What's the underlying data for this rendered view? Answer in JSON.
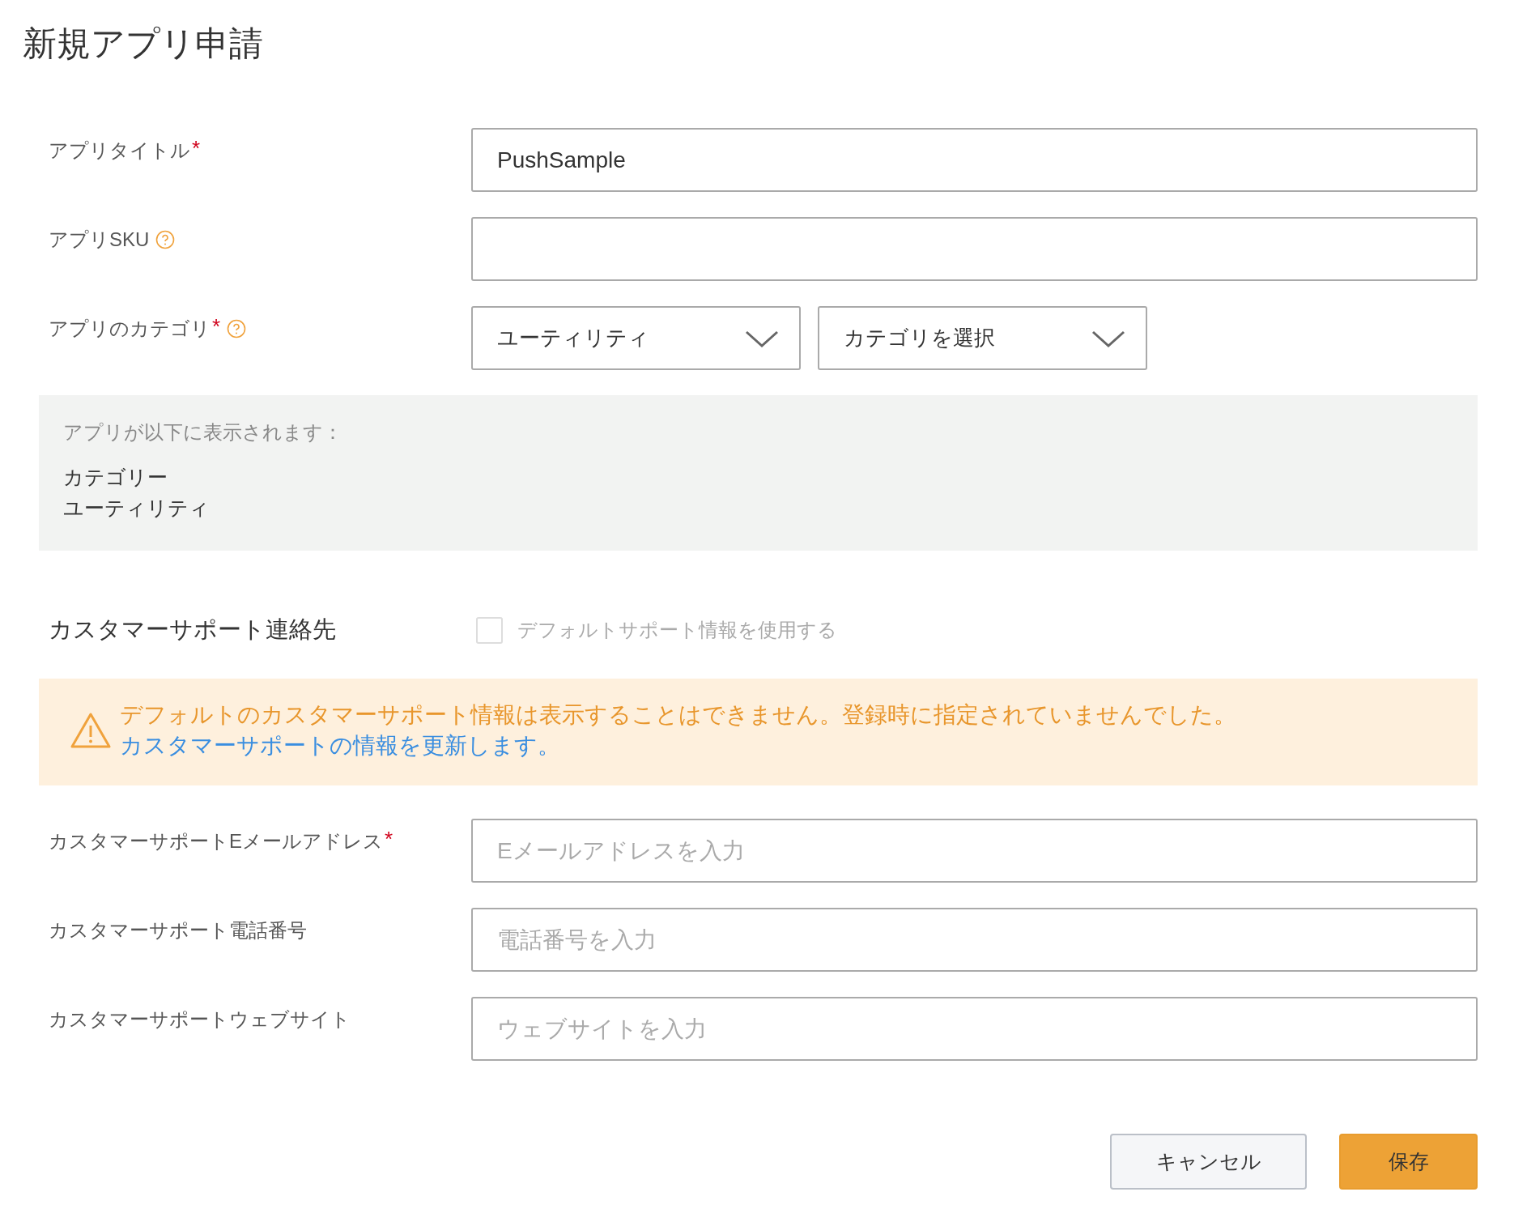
{
  "title": "新規アプリ申請",
  "app_fields": [
    {
      "kind": "text",
      "label": "アプリタイトル",
      "required_mark": "*",
      "help": false,
      "value": "PushSample"
    },
    {
      "kind": "text",
      "label": "アプリSKU",
      "help": true
    },
    {
      "kind": "select",
      "label": "アプリのカテゴリ",
      "required_mark": "*",
      "help": true,
      "selects": [
        {
          "value": "ユーティリティ"
        },
        {
          "value": "カテゴリを選択"
        }
      ]
    }
  ],
  "preview": {
    "heading": "アプリが以下に表示されます：",
    "lines": [
      "カテゴリー",
      "ユーティリティ"
    ]
  },
  "support": {
    "heading": "カスタマーサポート連絡先",
    "checkbox": {
      "label": "デフォルトサポート情報を使用する",
      "checked": false,
      "disabled": true
    }
  },
  "warning": {
    "text": "デフォルトのカスタマーサポート情報は表示することはできません。登録時に指定されていませんでした。",
    "link": "カスタマーサポートの情報を更新します。"
  },
  "support_fields": [
    {
      "label": "カスタマーサポートEメールアドレス",
      "required_mark": "*",
      "placeholder": "Eメールアドレスを入力"
    },
    {
      "label": "カスタマーサポート電話番号",
      "placeholder": "電話番号を入力"
    },
    {
      "label": "カスタマーサポートウェブサイト",
      "placeholder": "ウェブサイトを入力"
    }
  ],
  "buttons": [
    {
      "kind": "secondary",
      "label": "キャンセル"
    },
    {
      "kind": "primary",
      "label": "保存"
    }
  ]
}
